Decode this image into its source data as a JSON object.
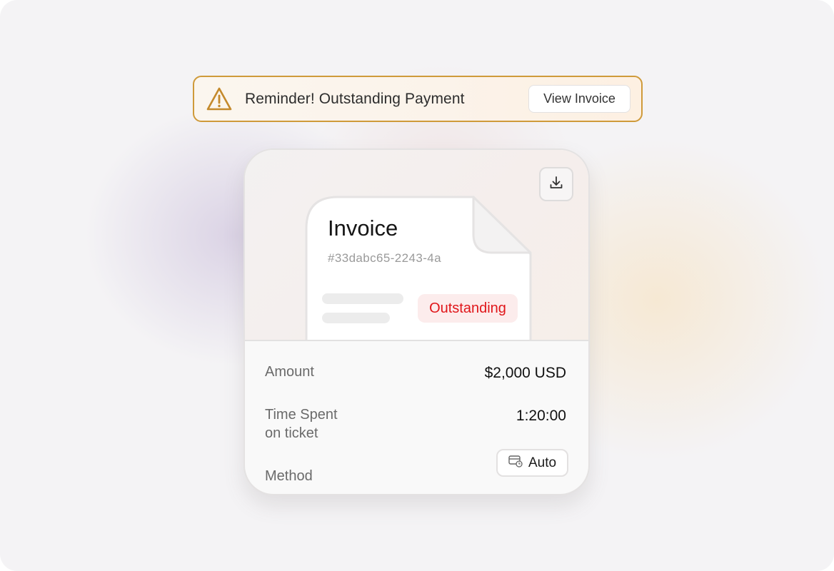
{
  "banner": {
    "icon": "warning-triangle-icon",
    "message": "Reminder! Outstanding Payment",
    "button_label": "View Invoice",
    "accent_color": "#cf9a3a"
  },
  "invoice": {
    "download_icon": "download-icon",
    "title": "Invoice",
    "id": "#33dabc65-2243-4a",
    "status": "Outstanding",
    "status_color": "#e0161a"
  },
  "details": {
    "amount_label": "Amount",
    "amount_value": "$2,000 USD",
    "time_label_line1": "Time Spent",
    "time_label_line2": "on ticket",
    "time_value": "1:20:00",
    "method_label": "Method",
    "method_icon": "credit-card-clock-icon",
    "method_value": "Auto"
  }
}
